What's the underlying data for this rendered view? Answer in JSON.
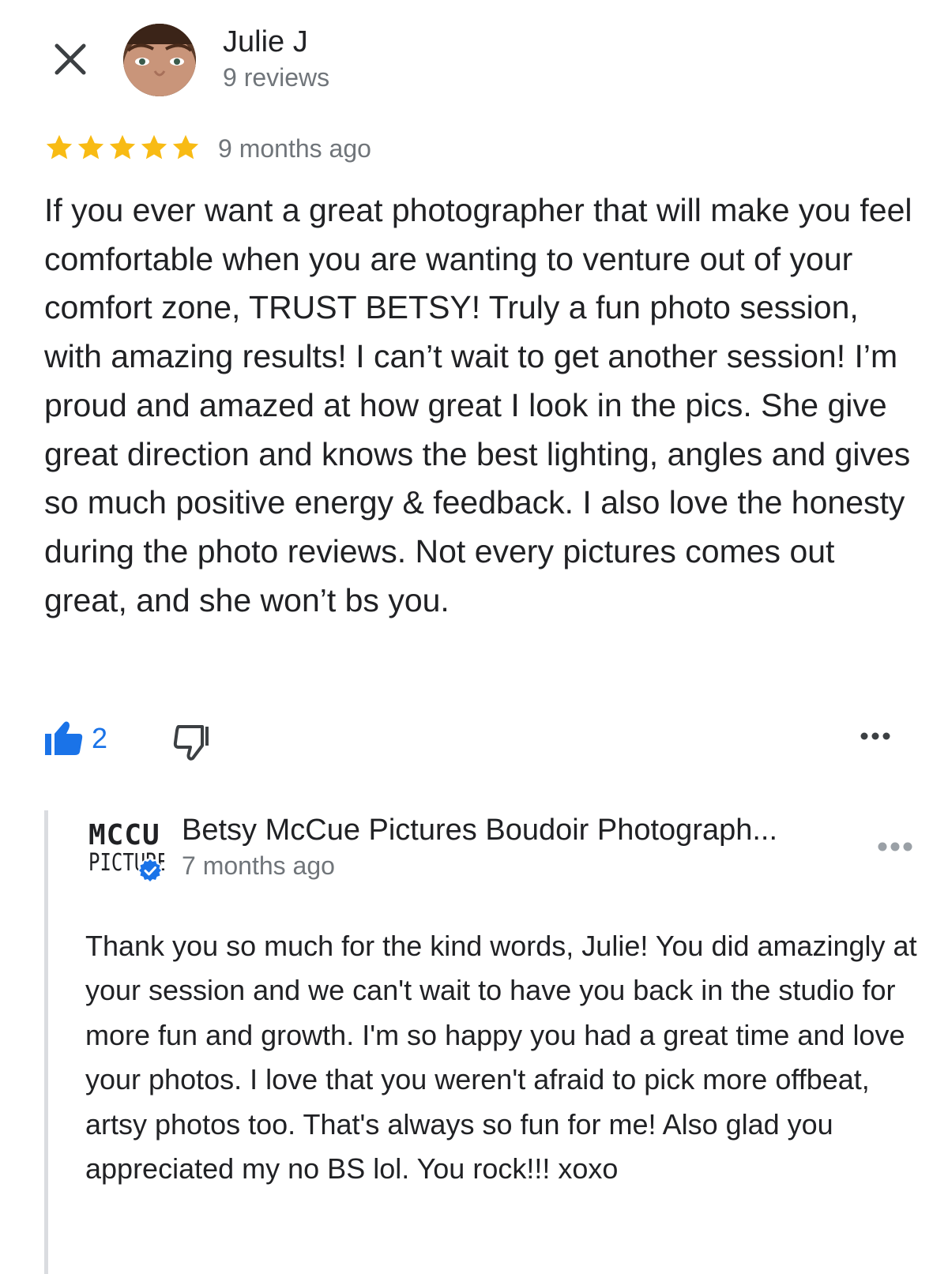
{
  "review": {
    "reviewer_name": "Julie J",
    "review_count": "9 reviews",
    "rating": 5,
    "time_ago": "9 months ago",
    "text": "If you ever want a great photographer that will make you feel comfortable when you are wanting to venture out of your comfort zone, TRUST BETSY! Truly a fun photo session, with amazing results! I can’t wait to get another session! I’m proud and amazed at how great I look in the pics. She give great direction and knows the best lighting, angles and gives so much positive energy & feedback. I also love the honesty during the photo reviews. Not every pictures comes out great, and she won’t bs you.",
    "like_count": "2"
  },
  "owner_reply": {
    "logo_line1": "MCCU",
    "logo_line2": "PICTURES",
    "name": "Betsy McCue Pictures Boudoir Photograph...",
    "time_ago": "7 months ago",
    "text": "Thank you so much for the kind words, Julie! You did amazingly at your session and we can't wait to have you back in the studio for more fun and growth. I'm so happy you had a great time and love your photos. I love that you weren't afraid to pick more offbeat, artsy photos too. That's always so fun for me! Also glad you appreciated my no BS lol. You rock!!! xoxo"
  },
  "icons": {
    "close": "close-icon",
    "avatar": "avatar",
    "star": "star-icon",
    "like": "thumbs-up-icon",
    "dislike": "thumbs-down-icon",
    "more": "more-horizontal-icon",
    "verified": "verified-check-icon"
  },
  "colors": {
    "star": "#f8bb14",
    "accent_blue": "#1a73e8",
    "secondary_text": "#70757a",
    "primary_text": "#202124",
    "reply_border": "#dadce0"
  }
}
